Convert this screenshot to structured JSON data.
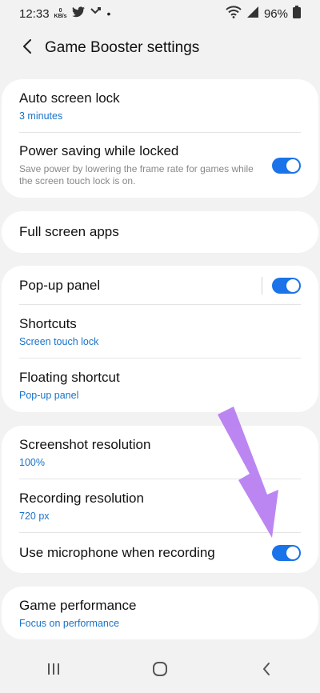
{
  "status_bar": {
    "time": "12:33",
    "data_rate_top": "0",
    "data_rate_bottom": "KB/s",
    "battery": "96%"
  },
  "header": {
    "title": "Game Booster settings"
  },
  "sections": {
    "lock": {
      "auto_screen_lock": {
        "label": "Auto screen lock",
        "value": "3 minutes"
      },
      "power_saving": {
        "label": "Power saving while locked",
        "description": "Save power by lowering the frame rate for games while the screen touch lock is on.",
        "enabled": true
      }
    },
    "apps": {
      "full_screen_apps": {
        "label": "Full screen apps"
      }
    },
    "panel": {
      "popup_panel": {
        "label": "Pop-up panel",
        "enabled": true
      },
      "shortcuts": {
        "label": "Shortcuts",
        "value": "Screen touch lock"
      },
      "floating_shortcut": {
        "label": "Floating shortcut",
        "value": "Pop-up panel"
      }
    },
    "recording": {
      "screenshot_resolution": {
        "label": "Screenshot resolution",
        "value": "100%"
      },
      "recording_resolution": {
        "label": "Recording resolution",
        "value": "720 px"
      },
      "use_microphone": {
        "label": "Use microphone when recording",
        "enabled": true
      }
    },
    "performance": {
      "game_performance": {
        "label": "Game performance",
        "value": "Focus on performance"
      }
    }
  },
  "colors": {
    "accent": "#1a73e8",
    "link_text": "#1a73c8",
    "annotation_arrow": "#b57cf0"
  },
  "icons": {
    "back": "arrow-left-icon",
    "nav_recents": "recents-icon",
    "nav_home": "home-icon",
    "nav_back": "back-chevron-icon"
  }
}
